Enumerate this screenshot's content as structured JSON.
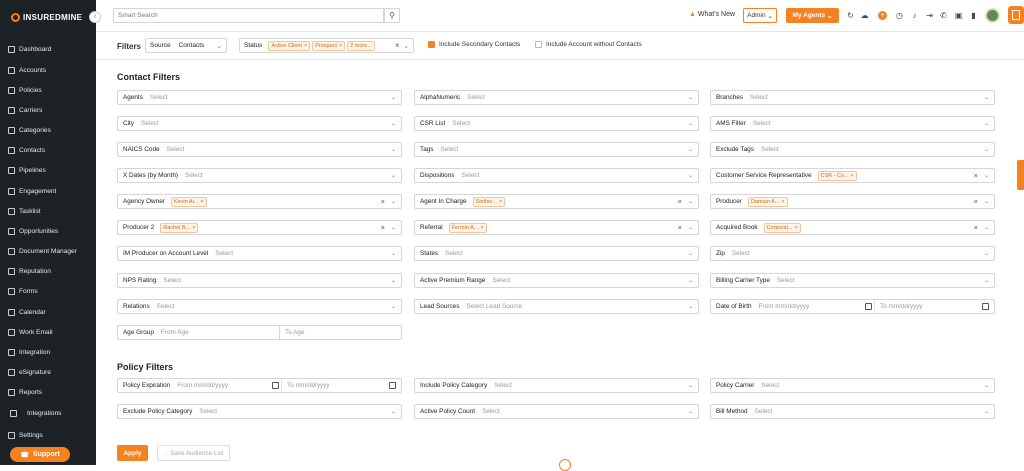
{
  "app": {
    "logo": "INSUREDMINE"
  },
  "sidebar": {
    "items": [
      {
        "label": "Dashboard",
        "icon": "dashboard-icon"
      },
      {
        "label": "Accounts",
        "icon": "accounts-icon"
      },
      {
        "label": "Policies",
        "icon": "policies-icon"
      },
      {
        "label": "Carriers",
        "icon": "carriers-icon"
      },
      {
        "label": "Categories",
        "icon": "categories-icon"
      },
      {
        "label": "Contacts",
        "icon": "contacts-icon"
      },
      {
        "label": "Pipelines",
        "icon": "pipelines-icon"
      },
      {
        "label": "Engagement",
        "icon": "megaphone-icon"
      },
      {
        "label": "Tasklist",
        "icon": "tasklist-icon"
      },
      {
        "label": "Opportunities",
        "icon": "opportunities-icon"
      },
      {
        "label": "Document Manager",
        "icon": "folder-icon"
      },
      {
        "label": "Reputation",
        "icon": "reputation-icon"
      },
      {
        "label": "Forms",
        "icon": "forms-icon"
      },
      {
        "label": "Calendar",
        "icon": "calendar-icon"
      },
      {
        "label": "Work Email",
        "icon": "email-icon"
      },
      {
        "label": "Integration",
        "icon": "integration-icon"
      },
      {
        "label": "eSignature",
        "icon": "esignature-icon"
      },
      {
        "label": "Reports",
        "icon": "reports-icon"
      },
      {
        "label": "Integrations",
        "icon": "integrations-icon"
      },
      {
        "label": "Settings",
        "icon": "gear-icon"
      }
    ],
    "support": "Support"
  },
  "topbar": {
    "search_placeholder": "Smart Search",
    "whats_new": "What's New",
    "admin": "Admin",
    "my_agents": "My Agents",
    "admin_chevron": "⌄",
    "agents_chevron": "⌄"
  },
  "filterbar": {
    "title": "Filters",
    "source_label": "Source",
    "source_value": "Contacts",
    "status_label": "Status",
    "status_chips": [
      "Active Client",
      "Prospect",
      "2 more..."
    ],
    "secondary_label": "Include Secondary Contacts",
    "without_label": "Include Account without Contacts"
  },
  "contact_filters": {
    "title": "Contact Filters",
    "fields": [
      {
        "label": "Agents",
        "value": "Select"
      },
      {
        "label": "AlphaNumeric",
        "value": "Select"
      },
      {
        "label": "Branches",
        "value": "Select"
      },
      {
        "label": "City",
        "value": "Select"
      },
      {
        "label": "CSR List",
        "value": "Select"
      },
      {
        "label": "AMS Filter",
        "value": "Select"
      },
      {
        "label": "NAICS Code",
        "value": "Select"
      },
      {
        "label": "Tags",
        "value": "Select"
      },
      {
        "label": "Exclude Tags",
        "value": "Select"
      },
      {
        "label": "X Dates (by Month)",
        "value": "Select"
      },
      {
        "label": "Dispositions",
        "value": "Select"
      },
      {
        "label": "Customer Service Representative",
        "chips": [
          "CSR - Co..."
        ]
      },
      {
        "label": "Agency Owner",
        "chips": [
          "Kevin Ai..."
        ]
      },
      {
        "label": "Agent In Charge",
        "chips": [
          "Sinthie..."
        ]
      },
      {
        "label": "Producer",
        "chips": [
          "Damian A..."
        ]
      },
      {
        "label": "Producer 2",
        "chips": [
          "Rachel B..."
        ]
      },
      {
        "label": "Referral",
        "chips": [
          "Fermin A..."
        ]
      },
      {
        "label": "Acquired Book",
        "chips": [
          "Corporat..."
        ]
      },
      {
        "label": "IM Producer on Account Level",
        "value": "Select"
      },
      {
        "label": "States",
        "value": "Select"
      },
      {
        "label": "Zip",
        "value": "Select"
      },
      {
        "label": "NPS Rating",
        "value": "Select"
      },
      {
        "label": "Active Premium Range",
        "value": "Select"
      },
      {
        "label": "Billing Carrier Type",
        "value": "Select"
      },
      {
        "label": "Relations",
        "value": "Select"
      },
      {
        "label": "Lead Sources",
        "value": "Select Lead Source"
      },
      {
        "label": "Date of Birth",
        "from": "From mm/dd/yyyy",
        "to": "To mm/dd/yyyy"
      },
      {
        "label": "Age Group",
        "from": "From Age",
        "to": "To Age"
      }
    ]
  },
  "policy_filters": {
    "title": "Policy Filters",
    "fields": [
      {
        "label": "Policy Expiration",
        "from": "From mm/dd/yyyy",
        "to": "To mm/dd/yyyy"
      },
      {
        "label": "Include Policy Category",
        "value": "Select"
      },
      {
        "label": "Policy Carrier",
        "value": "Select"
      },
      {
        "label": "Exclude Policy Category",
        "value": "Select"
      },
      {
        "label": "Active Policy Count",
        "value": "Select"
      },
      {
        "label": "Bill Method",
        "value": "Select"
      }
    ]
  },
  "actions": {
    "apply": "Apply",
    "save": "Save Audience List"
  },
  "glyphs": {
    "chevron": "⌄",
    "clear": "×",
    "chip_x": "×",
    "search": "⚲"
  }
}
